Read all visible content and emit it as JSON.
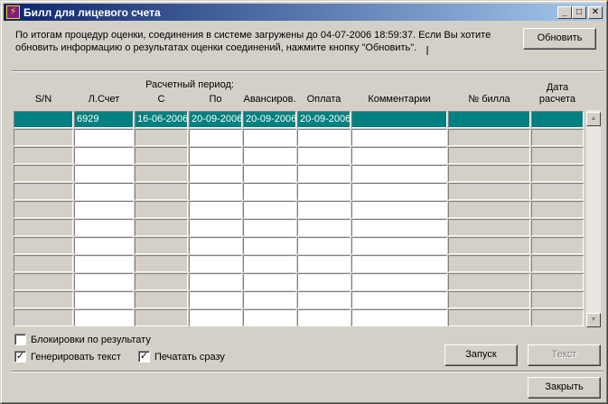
{
  "window": {
    "title": "Билл для лицевого счета",
    "app_icon": "lightning-app-icon",
    "controls": {
      "minimize": "_",
      "maximize": "□",
      "close": "✕"
    }
  },
  "info": {
    "text": "По итогам процедур оценки, соединения в системе загружены до 04-07-2006 18:59:37. Если Вы хотите обновить информацию о результатах оценки соединений, нажмите кнопку \"Обновить\"."
  },
  "buttons": {
    "refresh": "Обновить",
    "run": "Запуск",
    "text": "Текст",
    "close": "Закрыть"
  },
  "table": {
    "group_header": "Расчетный период:",
    "columns": {
      "sn": "S/N",
      "account": "Л.Счет",
      "from": "С",
      "to": "По",
      "advance": "Авансиров.",
      "payment": "Оплата",
      "comments": "Комментарии",
      "bill_no": "№ билла",
      "calc_date": "Дата расчета"
    },
    "rows": [
      {
        "sn": "",
        "account": "6929",
        "from": "16-06-2006",
        "to": "20-09-2006",
        "advance": "20-09-2006",
        "payment": "20-09-2006",
        "comments": "",
        "bill_no": "",
        "calc_date": "",
        "selected": true
      }
    ],
    "empty_rows": 11
  },
  "options": {
    "block_by_result": {
      "label": "Блокировки по результату",
      "checked": false
    },
    "generate_text": {
      "label": "Генерировать текст",
      "checked": true
    },
    "print_now": {
      "label": "Печатать сразу",
      "checked": true
    }
  }
}
